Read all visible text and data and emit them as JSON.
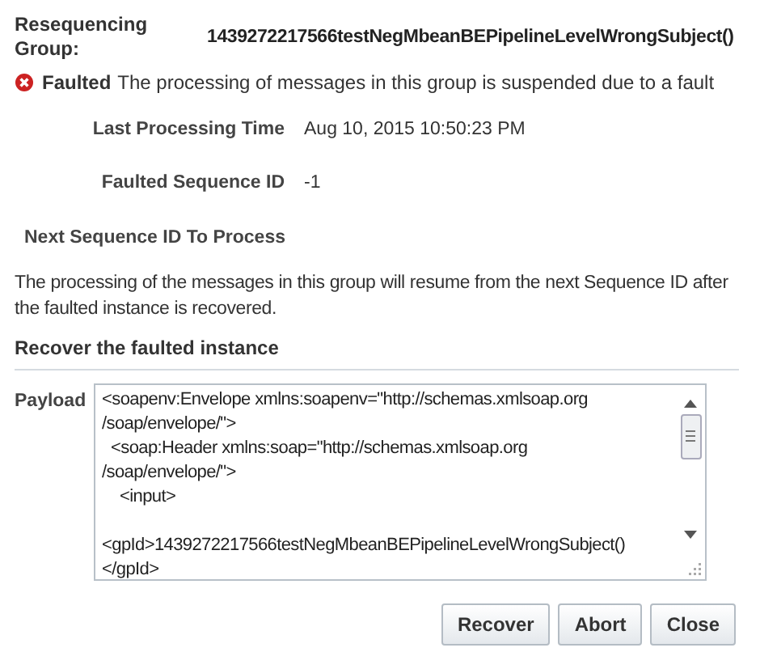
{
  "group": {
    "label": "Resequencing Group:",
    "value": "1439272217566testNegMbeanBEPipelineLevelWrongSubject()"
  },
  "status": {
    "kind": "faulted",
    "label": "Faulted",
    "message": "The processing of messages in this group is suspended due to a fault"
  },
  "fields": [
    {
      "label": "Last Processing Time",
      "value": "Aug 10, 2015 10:50:23 PM"
    },
    {
      "label": "Faulted Sequence ID",
      "value": "-1"
    }
  ],
  "next_sequence": {
    "label": "Next Sequence ID To Process"
  },
  "note": "The processing of the messages in this group will resume from the next Sequence ID after the faulted instance is recovered.",
  "section_title": "Recover the faulted instance",
  "payload": {
    "label": "Payload",
    "blocks": [
      [
        "<soapenv:Envelope xmlns:soapenv=\"http://schemas.xmlsoap.org",
        "/soap/envelope/\">",
        "  <soap:Header xmlns:soap=\"http://schemas.xmlsoap.org",
        "/soap/envelope/\">",
        "    <input>"
      ],
      [
        "<gpId>1439272217566testNegMbeanBEPipelineLevelWrongSubject()",
        "</gpId>"
      ]
    ]
  },
  "buttons": [
    "Recover",
    "Abort",
    "Close"
  ]
}
